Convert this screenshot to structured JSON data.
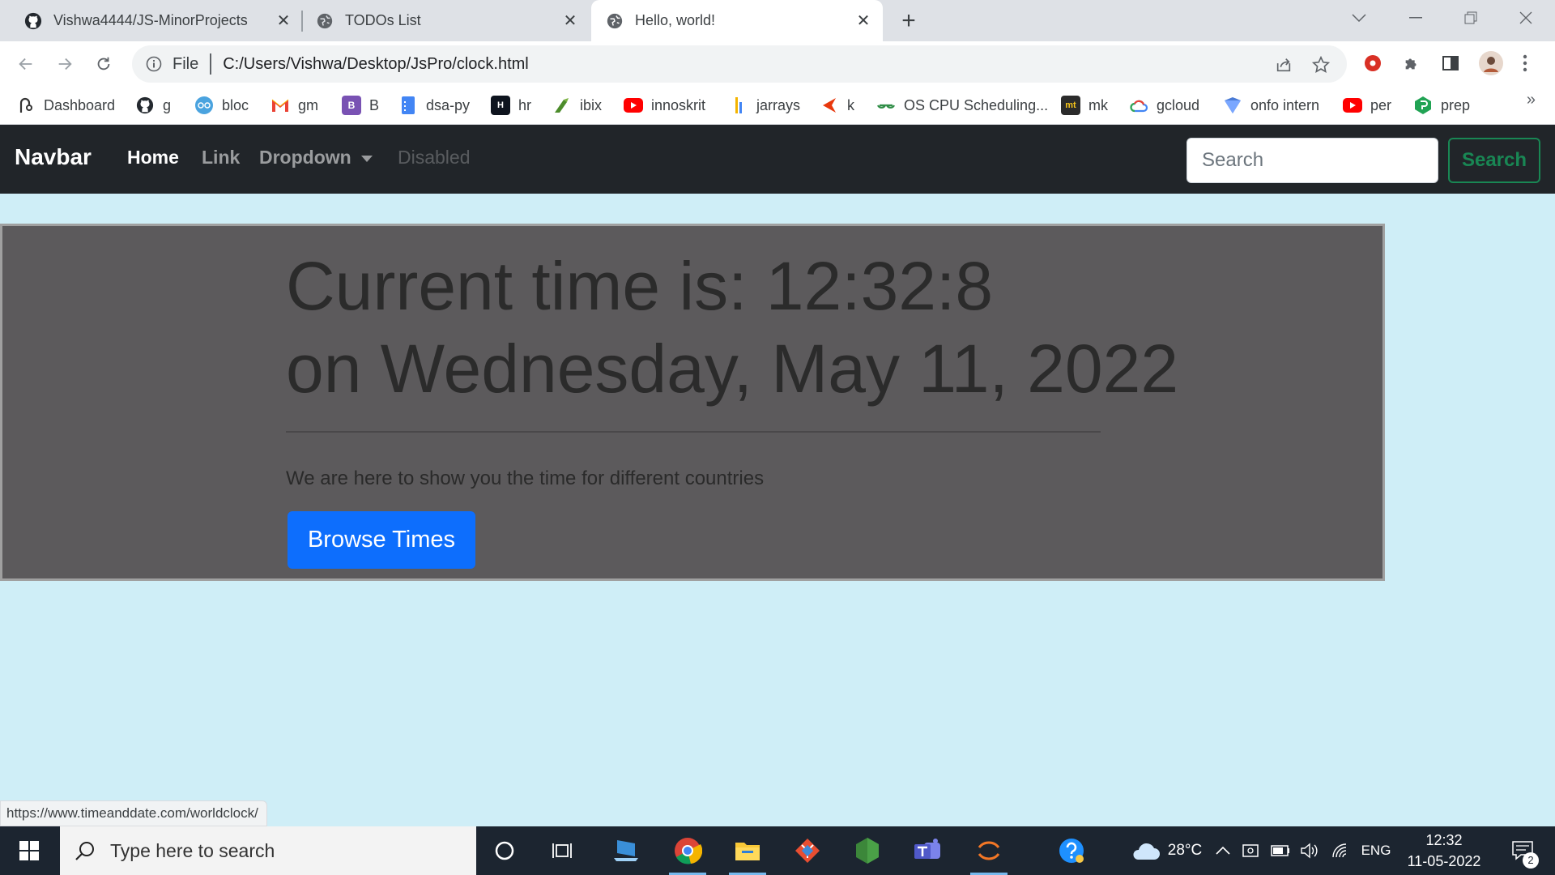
{
  "browser": {
    "tabs": [
      {
        "title": "Vishwa4444/JS-MinorProjects",
        "icon": "github-icon"
      },
      {
        "title": "TODOs List",
        "icon": "globe-icon"
      },
      {
        "title": "Hello, world!",
        "icon": "globe-icon",
        "active": true
      }
    ],
    "address": {
      "scheme_label": "File",
      "url": "C:/Users/Vishwa/Desktop/JsPro/clock.html"
    },
    "bookmarks": [
      {
        "label": "Dashboard",
        "icon": "dashboard-icon"
      },
      {
        "label": "g",
        "icon": "github-icon"
      },
      {
        "label": "bloc",
        "icon": "bloc-icon"
      },
      {
        "label": "gm",
        "icon": "gmail-icon"
      },
      {
        "label": "B",
        "icon": "bootstrap-icon"
      },
      {
        "label": "dsa-py",
        "icon": "doc-icon"
      },
      {
        "label": "hr",
        "icon": "hackerrank-icon"
      },
      {
        "label": "ibix",
        "icon": "ibix-icon"
      },
      {
        "label": "innoskrit",
        "icon": "youtube-icon"
      },
      {
        "label": "jarrays",
        "icon": "bar-icon"
      },
      {
        "label": "k",
        "icon": "k-icon"
      },
      {
        "label": "OS CPU Scheduling...",
        "icon": "gfg-icon"
      },
      {
        "label": "mk",
        "icon": "mt-icon"
      },
      {
        "label": "gcloud",
        "icon": "gcloud-icon"
      },
      {
        "label": "onfo intern",
        "icon": "onfo-icon"
      },
      {
        "label": "per",
        "icon": "youtube-icon"
      },
      {
        "label": "prep",
        "icon": "prep-icon"
      }
    ],
    "bookmarks_overflow": "»",
    "status_url": "https://www.timeanddate.com/worldclock/"
  },
  "navbar": {
    "brand": "Navbar",
    "links": {
      "home": "Home",
      "link": "Link",
      "dropdown": "Dropdown",
      "disabled": "Disabled"
    },
    "search_placeholder": "Search",
    "search_button": "Search"
  },
  "jumbotron": {
    "line1": "Current time is: 12:32:8",
    "line2": "on Wednesday, May 11, 2022",
    "lead": "We are here to show you the time for different countries",
    "button": "Browse Times"
  },
  "taskbar": {
    "search_text": "Type here to search",
    "weather": "28°C",
    "language": "ENG",
    "time": "12:32",
    "date": "11-05-2022",
    "notifications": "2"
  },
  "colors": {
    "navbar_bg": "#212529",
    "page_bg": "#cfeef7",
    "jumbo_bg": "#5c5a5c",
    "primary": "#0d6efd",
    "success": "#198754"
  }
}
